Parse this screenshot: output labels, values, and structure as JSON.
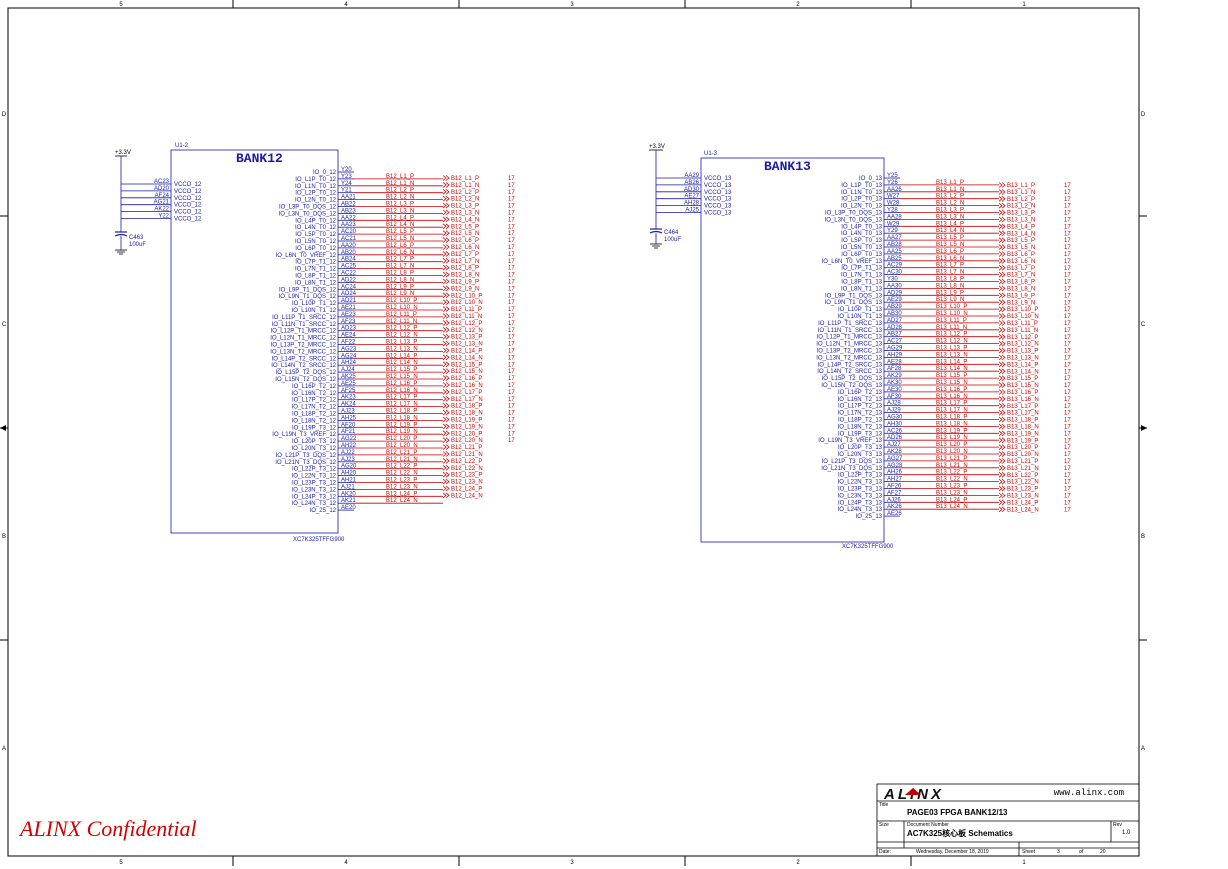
{
  "frame": {
    "cols_top": [
      "5",
      "4",
      "3",
      "2",
      "1"
    ],
    "cols_bottom": [
      "5",
      "4",
      "3",
      "2",
      "1"
    ],
    "rows": [
      "D",
      "C",
      "B",
      "A"
    ]
  },
  "left_block": {
    "ref": "U1-2",
    "bank": "BANK12",
    "part": "XC7K325TFFG900",
    "power_label": "+3.3V",
    "cap_ref": "C463",
    "cap_value": "100uF",
    "vcco_pins": [
      "AC23",
      "AD20",
      "AF24",
      "AG21",
      "AK22",
      "Y22"
    ],
    "vcco_label": "VCCO_12",
    "pins": [
      {
        "name": "IO_0_12",
        "pin": "Y20",
        "net": ""
      },
      {
        "name": "IO_L1P_T0_12",
        "pin": "Y23",
        "net": "B12_L1_P"
      },
      {
        "name": "IO_L1N_T0_12",
        "pin": "Y24",
        "net": "B12_L1_N"
      },
      {
        "name": "IO_L2P_T0_12",
        "pin": "Y21",
        "net": "B12_L2_P"
      },
      {
        "name": "IO_L2N_T0_12",
        "pin": "AA21",
        "net": "B12_L2_N"
      },
      {
        "name": "IO_L3P_T0_DQS_12",
        "pin": "AB22",
        "net": "B12_L3_P"
      },
      {
        "name": "IO_L3N_T0_DQS_12",
        "pin": "AB23",
        "net": "B12_L3_N"
      },
      {
        "name": "IO_L4P_T0_12",
        "pin": "AA22",
        "net": "B12_L4_P"
      },
      {
        "name": "IO_L4N_T0_12",
        "pin": "AA23",
        "net": "B12_L4_N"
      },
      {
        "name": "IO_L5P_T0_12",
        "pin": "AC20",
        "net": "B12_L5_P"
      },
      {
        "name": "IO_L5N_T0_12",
        "pin": "AC21",
        "net": "B12_L5_N"
      },
      {
        "name": "IO_L6P_T0_12",
        "pin": "AA20",
        "net": "B12_L6_P"
      },
      {
        "name": "IO_L6N_T0_VREF_12",
        "pin": "AB20",
        "net": "B12_L6_N"
      },
      {
        "name": "IO_L7P_T1_12",
        "pin": "AB24",
        "net": "B12_L7_P"
      },
      {
        "name": "IO_L7N_T1_12",
        "pin": "AC25",
        "net": "B12_L7_N"
      },
      {
        "name": "IO_L8P_T1_12",
        "pin": "AC22",
        "net": "B12_L8_P"
      },
      {
        "name": "IO_L8N_T1_12",
        "pin": "AD22",
        "net": "B12_L8_N"
      },
      {
        "name": "IO_L9P_T1_DQS_12",
        "pin": "AC24",
        "net": "B12_L9_P"
      },
      {
        "name": "IO_L9N_T1_DQS_12",
        "pin": "AD24",
        "net": "B12_L9_N"
      },
      {
        "name": "IO_L10P_T1_12",
        "pin": "AD21",
        "net": "B12_L10_P"
      },
      {
        "name": "IO_L10N_T1_12",
        "pin": "AE21",
        "net": "B12_L10_N"
      },
      {
        "name": "IO_L11P_T1_SRCC_12",
        "pin": "AE23",
        "net": "B12_L11_P"
      },
      {
        "name": "IO_L11N_T1_SRCC_12",
        "pin": "AF23",
        "net": "B12_L11_N"
      },
      {
        "name": "IO_L12P_T1_MRCC_12",
        "pin": "AD23",
        "net": "B12_L12_P"
      },
      {
        "name": "IO_L12N_T1_MRCC_12",
        "pin": "AE24",
        "net": "B12_L12_N"
      },
      {
        "name": "IO_L13P_T2_MRCC_12",
        "pin": "AF22",
        "net": "B12_L13_P"
      },
      {
        "name": "IO_L13N_T2_MRCC_12",
        "pin": "AG23",
        "net": "B12_L13_N"
      },
      {
        "name": "IO_L14P_T2_SRCC_12",
        "pin": "AG24",
        "net": "B12_L14_P"
      },
      {
        "name": "IO_L14N_T2_SRCC_12",
        "pin": "AH24",
        "net": "B12_L14_N"
      },
      {
        "name": "IO_L15P_T2_DQS_12",
        "pin": "AJ24",
        "net": "B12_L15_P"
      },
      {
        "name": "IO_L15N_T2_DQS_12",
        "pin": "AK25",
        "net": "B12_L15_N"
      },
      {
        "name": "IO_L16P_T2_12",
        "pin": "AE25",
        "net": "B12_L16_P"
      },
      {
        "name": "IO_L16N_T2_12",
        "pin": "AF25",
        "net": "B12_L16_N"
      },
      {
        "name": "IO_L17P_T2_12",
        "pin": "AK23",
        "net": "B12_L17_P"
      },
      {
        "name": "IO_L17N_T2_12",
        "pin": "AK24",
        "net": "B12_L17_N"
      },
      {
        "name": "IO_L18P_T2_12",
        "pin": "AJ23",
        "net": "B12_L18_P"
      },
      {
        "name": "IO_L18N_T2_12",
        "pin": "AH25",
        "net": "B12_L18_N"
      },
      {
        "name": "IO_L19P_T3_12",
        "pin": "AF20",
        "net": "B12_L19_P"
      },
      {
        "name": "IO_L19N_T3_VREF_12",
        "pin": "AF21",
        "net": "B12_L19_N"
      },
      {
        "name": "IO_L20P_T3_12",
        "pin": "AG22",
        "net": "B12_L20_P"
      },
      {
        "name": "IO_L20N_T3_12",
        "pin": "AH22",
        "net": "B12_L20_N"
      },
      {
        "name": "IO_L21P_T3_DQS_12",
        "pin": "AJ22",
        "net": "B12_L21_P"
      },
      {
        "name": "IO_L21N_T3_DQS_12",
        "pin": "AJ23",
        "net": "B12_L21_N"
      },
      {
        "name": "IO_L22P_T3_12",
        "pin": "AG20",
        "net": "B12_L22_P"
      },
      {
        "name": "IO_L22N_T3_12",
        "pin": "AH20",
        "net": "B12_L22_N"
      },
      {
        "name": "IO_L23P_T3_12",
        "pin": "AH21",
        "net": "B12_L23_P"
      },
      {
        "name": "IO_L23N_T3_12",
        "pin": "AJ21",
        "net": "B12_L23_N"
      },
      {
        "name": "IO_L24P_T3_12",
        "pin": "AK20",
        "net": "B12_L24_P"
      },
      {
        "name": "IO_L24N_T3_12",
        "pin": "AK21",
        "net": "B12_L24_N"
      },
      {
        "name": "IO_25_12",
        "pin": "AE20",
        "net": ""
      }
    ],
    "ports": [
      {
        "label": "B12_L1_P",
        "page": "17"
      },
      {
        "label": "B12_L1_N",
        "page": "17"
      },
      {
        "label": "B12_L2_P",
        "page": "17"
      },
      {
        "label": "B12_L2_N",
        "page": "17"
      },
      {
        "label": "B12_L3_P",
        "page": "17"
      },
      {
        "label": "B12_L3_N",
        "page": "17"
      },
      {
        "label": "B12_L4_N",
        "page": "17"
      },
      {
        "label": "B12_L5_P",
        "page": "17"
      },
      {
        "label": "B12_L5_N",
        "page": "17"
      },
      {
        "label": "B12_L6_P",
        "page": "17"
      },
      {
        "label": "B12_L6_N",
        "page": "17"
      },
      {
        "label": "B12_L7_P",
        "page": "17"
      },
      {
        "label": "B12_L7_N",
        "page": "17"
      },
      {
        "label": "B12_L8_P",
        "page": "17"
      },
      {
        "label": "B12_L8_N",
        "page": "17"
      },
      {
        "label": "B12_L9_P",
        "page": "17"
      },
      {
        "label": "B12_L9_N",
        "page": "17"
      },
      {
        "label": "B12_L10_P",
        "page": "17"
      },
      {
        "label": "B12_L10_N",
        "page": "17"
      },
      {
        "label": "B12_L11_P",
        "page": "17"
      },
      {
        "label": "B12_L11_N",
        "page": "17"
      },
      {
        "label": "B12_L12_P",
        "page": "17"
      },
      {
        "label": "B12_L12_N",
        "page": "17"
      },
      {
        "label": "B12_L13_P",
        "page": "17"
      },
      {
        "label": "B12_L13_N",
        "page": "17"
      },
      {
        "label": "B12_L14_P",
        "page": "17"
      },
      {
        "label": "B12_L14_N",
        "page": "17"
      },
      {
        "label": "B12_L15_P",
        "page": "17"
      },
      {
        "label": "B12_L15_N",
        "page": "17"
      },
      {
        "label": "B12_L16_P",
        "page": "17"
      },
      {
        "label": "B12_L16_N",
        "page": "17"
      },
      {
        "label": "B12_L17_P",
        "page": "17"
      },
      {
        "label": "B12_L17_N",
        "page": "17"
      },
      {
        "label": "B12_L18_P",
        "page": "17"
      },
      {
        "label": "B12_L18_N",
        "page": "17"
      },
      {
        "label": "B12_L19_P",
        "page": "17"
      },
      {
        "label": "B12_L19_N",
        "page": "17"
      },
      {
        "label": "B12_L20_P",
        "page": "17"
      },
      {
        "label": "B12_L20_N",
        "page": "17"
      },
      {
        "label": "B12_L21_P",
        "page": ""
      },
      {
        "label": "B12_L21_N",
        "page": ""
      },
      {
        "label": "B12_L22_P",
        "page": ""
      },
      {
        "label": "B12_L22_N",
        "page": ""
      },
      {
        "label": "B12_L23_P",
        "page": ""
      },
      {
        "label": "B12_L23_N",
        "page": ""
      },
      {
        "label": "B12_L24_P",
        "page": ""
      },
      {
        "label": "B12_L24_N",
        "page": ""
      }
    ]
  },
  "right_block": {
    "ref": "U1-3",
    "bank": "BANK13",
    "part": "XC7K325TFFG900",
    "power_label": "+3.3V",
    "cap_ref": "C464",
    "cap_value": "100uF",
    "vcco_pins": [
      "AA29",
      "AB26",
      "AD30",
      "AE27",
      "AH28",
      "AJ25"
    ],
    "vcco_label": "VCCO_13",
    "pins": [
      {
        "name": "IO_0_13",
        "pin": "Y25",
        "net": ""
      },
      {
        "name": "IO_L1P_T0_13",
        "pin": "Y26",
        "net": "B13_L1_P"
      },
      {
        "name": "IO_L1N_T0_13",
        "pin": "AA26",
        "net": "B13_L1_N"
      },
      {
        "name": "IO_L2P_T0_13",
        "pin": "W27",
        "net": "B13_L2_P"
      },
      {
        "name": "IO_L2N_T0_13",
        "pin": "W28",
        "net": "B13_L2_N"
      },
      {
        "name": "IO_L3P_T0_DQS_13",
        "pin": "Y28",
        "net": "B13_L3_P"
      },
      {
        "name": "IO_L3N_T0_DQS_13",
        "pin": "AA28",
        "net": "B13_L3_N"
      },
      {
        "name": "IO_L4P_T0_13",
        "pin": "W29",
        "net": "B13_L4_P"
      },
      {
        "name": "IO_L4N_T0_13",
        "pin": "Y29",
        "net": "B13_L4_N"
      },
      {
        "name": "IO_L5P_T0_13",
        "pin": "AA27",
        "net": "B13_L5_P"
      },
      {
        "name": "IO_L5N_T0_13",
        "pin": "AB28",
        "net": "B13_L5_N"
      },
      {
        "name": "IO_L6P_T0_13",
        "pin": "AA25",
        "net": "B13_L6_P"
      },
      {
        "name": "IO_L6N_T0_VREF_13",
        "pin": "AB25",
        "net": "B13_L6_N"
      },
      {
        "name": "IO_L7P_T1_13",
        "pin": "AC29",
        "net": "B13_L7_P"
      },
      {
        "name": "IO_L7N_T1_13",
        "pin": "AC30",
        "net": "B13_L7_N"
      },
      {
        "name": "IO_L8P_T1_13",
        "pin": "Y30",
        "net": "B13_L8_P"
      },
      {
        "name": "IO_L8N_T1_13",
        "pin": "AA30",
        "net": "B13_L8_N"
      },
      {
        "name": "IO_L9P_T1_DQS_13",
        "pin": "AD29",
        "net": "B13_L9_P"
      },
      {
        "name": "IO_L9N_T1_DQS_13",
        "pin": "AE29",
        "net": "B13_L9_N"
      },
      {
        "name": "IO_L10P_T1_13",
        "pin": "AB29",
        "net": "B13_L10_P"
      },
      {
        "name": "IO_L10N_T1_13",
        "pin": "AB30",
        "net": "B13_L10_N"
      },
      {
        "name": "IO_L11P_T1_SRCC_13",
        "pin": "AD27",
        "net": "B13_L11_P"
      },
      {
        "name": "IO_L11N_T1_SRCC_13",
        "pin": "AD28",
        "net": "B13_L11_N"
      },
      {
        "name": "IO_L12P_T1_MRCC_13",
        "pin": "AB27",
        "net": "B13_L12_P"
      },
      {
        "name": "IO_L12N_T1_MRCC_13",
        "pin": "AC27",
        "net": "B13_L12_N"
      },
      {
        "name": "IO_L13P_T2_MRCC_13",
        "pin": "AG29",
        "net": "B13_L13_P"
      },
      {
        "name": "IO_L13N_T2_MRCC_13",
        "pin": "AH29",
        "net": "B13_L13_N"
      },
      {
        "name": "IO_L14P_T2_SRCC_13",
        "pin": "AE28",
        "net": "B13_L14_P"
      },
      {
        "name": "IO_L14N_T2_SRCC_13",
        "pin": "AF28",
        "net": "B13_L14_N"
      },
      {
        "name": "IO_L15P_T2_DQS_13",
        "pin": "AK29",
        "net": "B13_L15_P"
      },
      {
        "name": "IO_L15N_T2_DQS_13",
        "pin": "AK30",
        "net": "B13_L15_N"
      },
      {
        "name": "IO_L16P_T2_13",
        "pin": "AE30",
        "net": "B13_L16_P"
      },
      {
        "name": "IO_L16N_T2_13",
        "pin": "AF30",
        "net": "B13_L16_N"
      },
      {
        "name": "IO_L17P_T2_13",
        "pin": "AJ28",
        "net": "B13_L17_P"
      },
      {
        "name": "IO_L17N_T2_13",
        "pin": "AJ29",
        "net": "B13_L17_N"
      },
      {
        "name": "IO_L18P_T2_13",
        "pin": "AG30",
        "net": "B13_L18_P"
      },
      {
        "name": "IO_L18N_T2_13",
        "pin": "AH30",
        "net": "B13_L18_N"
      },
      {
        "name": "IO_L19P_T3_13",
        "pin": "AC26",
        "net": "B13_L19_P"
      },
      {
        "name": "IO_L19N_T3_VREF_13",
        "pin": "AD26",
        "net": "B13_L19_N"
      },
      {
        "name": "IO_L20P_T3_13",
        "pin": "AJ27",
        "net": "B13_L20_P"
      },
      {
        "name": "IO_L20N_T3_13",
        "pin": "AK28",
        "net": "B13_L20_N"
      },
      {
        "name": "IO_L21P_T3_DQS_13",
        "pin": "AG27",
        "net": "B13_L21_P"
      },
      {
        "name": "IO_L21N_T3_DQS_13",
        "pin": "AG28",
        "net": "B13_L21_N"
      },
      {
        "name": "IO_L22P_T3_13",
        "pin": "AH26",
        "net": "B13_L22_P"
      },
      {
        "name": "IO_L22N_T3_13",
        "pin": "AH27",
        "net": "B13_L22_N"
      },
      {
        "name": "IO_L23P_T3_13",
        "pin": "AF26",
        "net": "B13_L23_P"
      },
      {
        "name": "IO_L23N_T3_13",
        "pin": "AF27",
        "net": "B13_L23_N"
      },
      {
        "name": "IO_L24P_T3_13",
        "pin": "AJ26",
        "net": "B13_L24_P"
      },
      {
        "name": "IO_L24N_T3_13",
        "pin": "AK26",
        "net": "B13_L24_N"
      },
      {
        "name": "IO_25_13",
        "pin": "AE26",
        "net": ""
      }
    ],
    "ports": [
      {
        "label": "B13_L1_P",
        "page": "17"
      },
      {
        "label": "B13_L1_N",
        "page": "17"
      },
      {
        "label": "B13_L2_P",
        "page": "17"
      },
      {
        "label": "B13_L2_N",
        "page": "17"
      },
      {
        "label": "B13_L3_P",
        "page": "17"
      },
      {
        "label": "B13_L3_N",
        "page": "17"
      },
      {
        "label": "B13_L4_P",
        "page": "17"
      },
      {
        "label": "B13_L4_N",
        "page": "17"
      },
      {
        "label": "B13_L5_P",
        "page": "17"
      },
      {
        "label": "B13_L5_N",
        "page": "17"
      },
      {
        "label": "B13_L6_P",
        "page": "17"
      },
      {
        "label": "B13_L6_N",
        "page": "17"
      },
      {
        "label": "B13_L7_P",
        "page": "17"
      },
      {
        "label": "B13_L7_N",
        "page": "17"
      },
      {
        "label": "B13_L8_P",
        "page": "17"
      },
      {
        "label": "B13_L8_N",
        "page": "17"
      },
      {
        "label": "B13_L9_P",
        "page": "17"
      },
      {
        "label": "B13_L9_N",
        "page": "17"
      },
      {
        "label": "B13_L10_P",
        "page": "17"
      },
      {
        "label": "B13_L10_N",
        "page": "17"
      },
      {
        "label": "B13_L11_P",
        "page": "17"
      },
      {
        "label": "B13_L11_N",
        "page": "17"
      },
      {
        "label": "B13_L12_P",
        "page": "17"
      },
      {
        "label": "B13_L12_N",
        "page": "17"
      },
      {
        "label": "B13_L13_P",
        "page": "17"
      },
      {
        "label": "B13_L13_N",
        "page": "17"
      },
      {
        "label": "B13_L14_P",
        "page": "17"
      },
      {
        "label": "B13_L14_N",
        "page": "17"
      },
      {
        "label": "B13_L15_P",
        "page": "17"
      },
      {
        "label": "B13_L15_N",
        "page": "17"
      },
      {
        "label": "B13_L16_P",
        "page": "17"
      },
      {
        "label": "B13_L16_N",
        "page": "17"
      },
      {
        "label": "B13_L17_P",
        "page": "17"
      },
      {
        "label": "B13_L17_N",
        "page": "17"
      },
      {
        "label": "B13_L18_P",
        "page": "17"
      },
      {
        "label": "B13_L18_N",
        "page": "17"
      },
      {
        "label": "B13_L19_N",
        "page": "17"
      },
      {
        "label": "B13_L19_P",
        "page": "17"
      },
      {
        "label": "B13_L20_P",
        "page": "17"
      },
      {
        "label": "B13_L20_N",
        "page": "17"
      },
      {
        "label": "B13_L21_P",
        "page": "17"
      },
      {
        "label": "B13_L21_N",
        "page": "17"
      },
      {
        "label": "B13_L22_P",
        "page": "17"
      },
      {
        "label": "B13_L22_N",
        "page": "17"
      },
      {
        "label": "B13_L23_P",
        "page": "17"
      },
      {
        "label": "B13_L23_N",
        "page": "17"
      },
      {
        "label": "B13_L24_P",
        "page": "17"
      },
      {
        "label": "B13_L24_N",
        "page": "17"
      }
    ]
  },
  "confidential": "ALINX Confidential",
  "title_block": {
    "logo": "ALINX",
    "url": "www.alinx.com",
    "title_caption": "Title",
    "title": "PAGE03 FPGA BANK12/13",
    "size_caption": "Size",
    "docnum_caption": "Document Number",
    "doc_number": "AC7K325核心板 Schematics",
    "rev_caption": "Rev",
    "rev": "1.0",
    "date_caption": "Date:",
    "date": "Wednesday, December 18, 2019",
    "sheet_caption": "Sheet",
    "sheet": "3",
    "of_caption": "of",
    "total": "20"
  },
  "colors": {
    "frame": "#000000",
    "schematic": "#1a1aa8",
    "net": "#cc0000",
    "accent_logo": "#c00000"
  }
}
